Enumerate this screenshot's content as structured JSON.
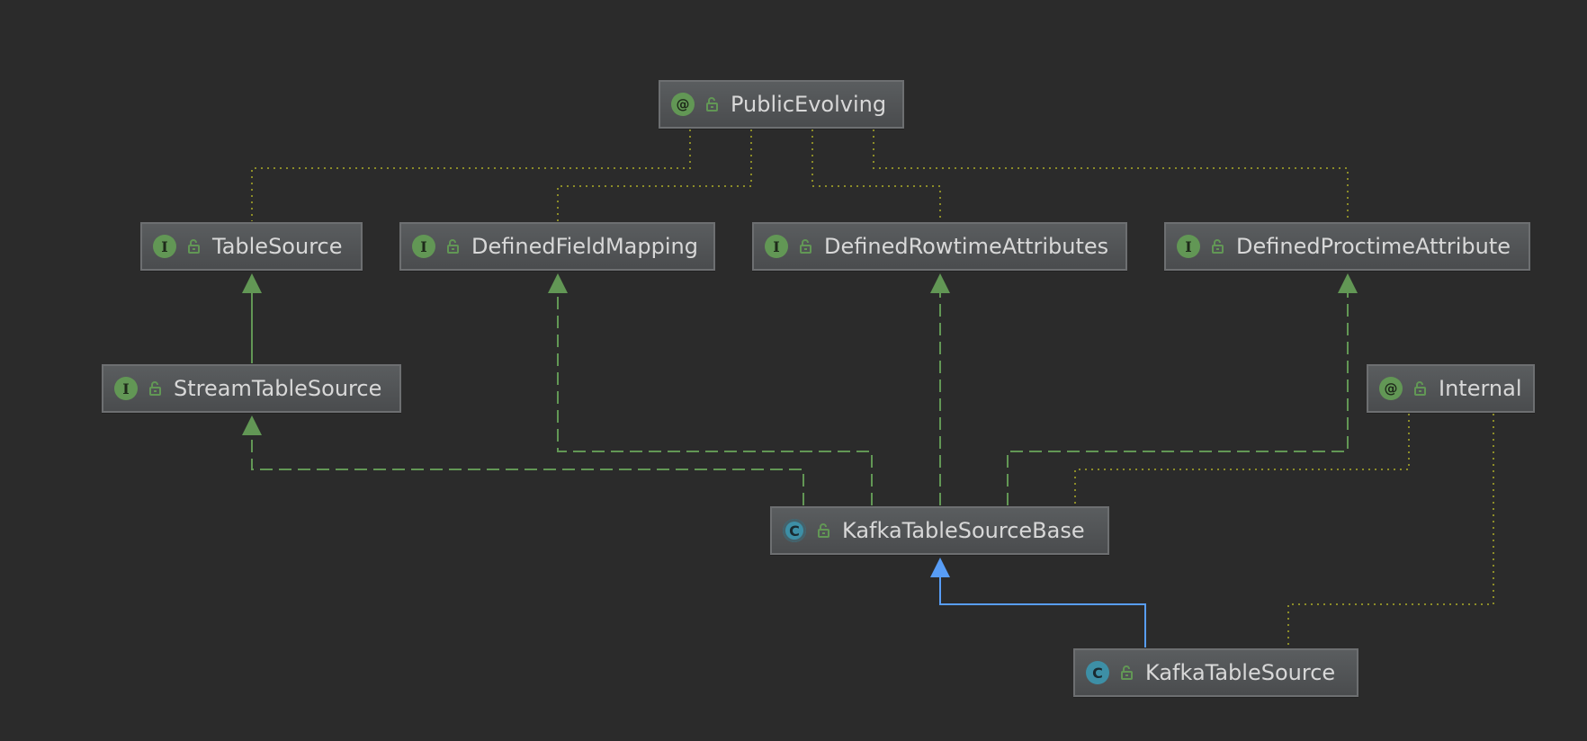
{
  "diagram": {
    "nodes": [
      {
        "id": "public_evolving",
        "label": "PublicEvolving",
        "kind": "annotation",
        "kind_glyph": "@",
        "visibility_icon": "public-lock-icon"
      },
      {
        "id": "table_source",
        "label": "TableSource",
        "kind": "interface",
        "kind_glyph": "I",
        "visibility_icon": "public-lock-icon"
      },
      {
        "id": "defined_field_mapping",
        "label": "DefinedFieldMapping",
        "kind": "interface",
        "kind_glyph": "I",
        "visibility_icon": "public-lock-icon"
      },
      {
        "id": "defined_rowtime_attributes",
        "label": "DefinedRowtimeAttributes",
        "kind": "interface",
        "kind_glyph": "I",
        "visibility_icon": "public-lock-icon"
      },
      {
        "id": "defined_proctime_attribute",
        "label": "DefinedProctimeAttribute",
        "kind": "interface",
        "kind_glyph": "I",
        "visibility_icon": "public-lock-icon"
      },
      {
        "id": "stream_table_source",
        "label": "StreamTableSource",
        "kind": "interface",
        "kind_glyph": "I",
        "visibility_icon": "public-lock-icon"
      },
      {
        "id": "internal",
        "label": "Internal",
        "kind": "annotation",
        "kind_glyph": "@",
        "visibility_icon": "public-lock-icon"
      },
      {
        "id": "kafka_table_source_base",
        "label": "KafkaTableSourceBase",
        "kind": "abstract",
        "kind_glyph": "C",
        "visibility_icon": "public-lock-icon"
      },
      {
        "id": "kafka_table_source",
        "label": "KafkaTableSource",
        "kind": "class",
        "kind_glyph": "C",
        "visibility_icon": "public-lock-icon"
      }
    ],
    "edges": [
      {
        "from": "stream_table_source",
        "to": "table_source",
        "type": "extends-interface"
      },
      {
        "from": "kafka_table_source_base",
        "to": "stream_table_source",
        "type": "implements"
      },
      {
        "from": "kafka_table_source_base",
        "to": "defined_field_mapping",
        "type": "implements"
      },
      {
        "from": "kafka_table_source_base",
        "to": "defined_rowtime_attributes",
        "type": "implements"
      },
      {
        "from": "kafka_table_source_base",
        "to": "defined_proctime_attribute",
        "type": "implements"
      },
      {
        "from": "kafka_table_source",
        "to": "kafka_table_source_base",
        "type": "extends-class"
      },
      {
        "from": "public_evolving",
        "to": "table_source",
        "type": "annotated"
      },
      {
        "from": "public_evolving",
        "to": "defined_field_mapping",
        "type": "annotated"
      },
      {
        "from": "public_evolving",
        "to": "defined_rowtime_attributes",
        "type": "annotated"
      },
      {
        "from": "public_evolving",
        "to": "defined_proctime_attribute",
        "type": "annotated"
      },
      {
        "from": "internal",
        "to": "kafka_table_source_base",
        "type": "annotated"
      },
      {
        "from": "internal",
        "to": "kafka_table_source",
        "type": "annotated"
      }
    ],
    "colors": {
      "background": "#2b2b2b",
      "interface_edge": "#629755",
      "class_edge": "#589df6",
      "annotation_edge": "#8c8c28",
      "interface_badge": "#629755",
      "class_badge": "#3d8fa6",
      "text": "#d8d8d8"
    }
  }
}
